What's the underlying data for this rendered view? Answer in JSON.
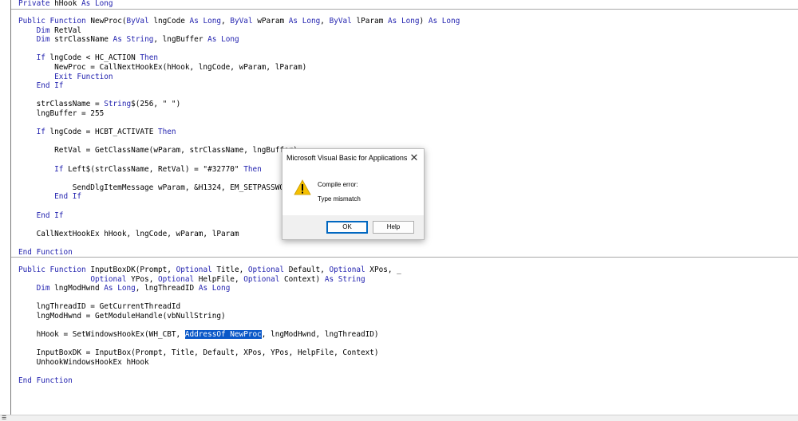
{
  "code": {
    "block0": [
      "Private hHook As Long"
    ],
    "proc1": [
      "Public Function NewProc(ByVal lngCode As Long, ByVal wParam As Long, ByVal lParam As Long) As Long",
      "    Dim RetVal",
      "    Dim strClassName As String, lngBuffer As Long",
      "",
      "    If lngCode < HC_ACTION Then",
      "        NewProc = CallNextHookEx(hHook, lngCode, wParam, lParam)",
      "        Exit Function",
      "    End If",
      "",
      "    strClassName = String$(256, \" \")",
      "    lngBuffer = 255",
      "",
      "    If lngCode = HCBT_ACTIVATE Then",
      "",
      "        RetVal = GetClassName(wParam, strClassName, lngBuffer)",
      "",
      "        If Left$(strClassName, RetVal) = \"#32770\" Then",
      "",
      "            SendDlgItemMessage wParam, &H1324, EM_SETPASSWORDCHAR, 42, 0",
      "        End If",
      "",
      "    End If",
      "",
      "    CallNextHookEx hHook, lngCode, wParam, lParam",
      "",
      "End Function"
    ],
    "proc2": [
      "Public Function InputBoxDK(Prompt, Optional Title, Optional Default, Optional XPos, _",
      "                Optional YPos, Optional HelpFile, Optional Context) As String",
      "    Dim lngModHwnd As Long, lngThreadID As Long",
      "",
      "    lngThreadID = GetCurrentThreadId",
      "    lngModHwnd = GetModuleHandle(vbNullString)",
      "",
      "    hHook = SetWindowsHookEx(WH_CBT, AddressOf NewProc, lngModHwnd, lngThreadID)",
      "",
      "    InputBoxDK = InputBox(Prompt, Title, Default, XPos, YPos, HelpFile, Context)",
      "    UnhookWindowsHookEx hHook",
      "",
      "End Function"
    ],
    "selected_text": "AddressOf NewProc"
  },
  "dialog": {
    "title": "Microsoft Visual Basic for Applications",
    "close_glyph": "✕",
    "error_title": "Compile error:",
    "error_message": "Type mismatch",
    "ok_label": "OK",
    "help_label": "Help",
    "icon": "warning-icon"
  },
  "colors": {
    "keyword": "#1f1fae",
    "selection": "#0a58c8",
    "warning": "#f5c000"
  }
}
